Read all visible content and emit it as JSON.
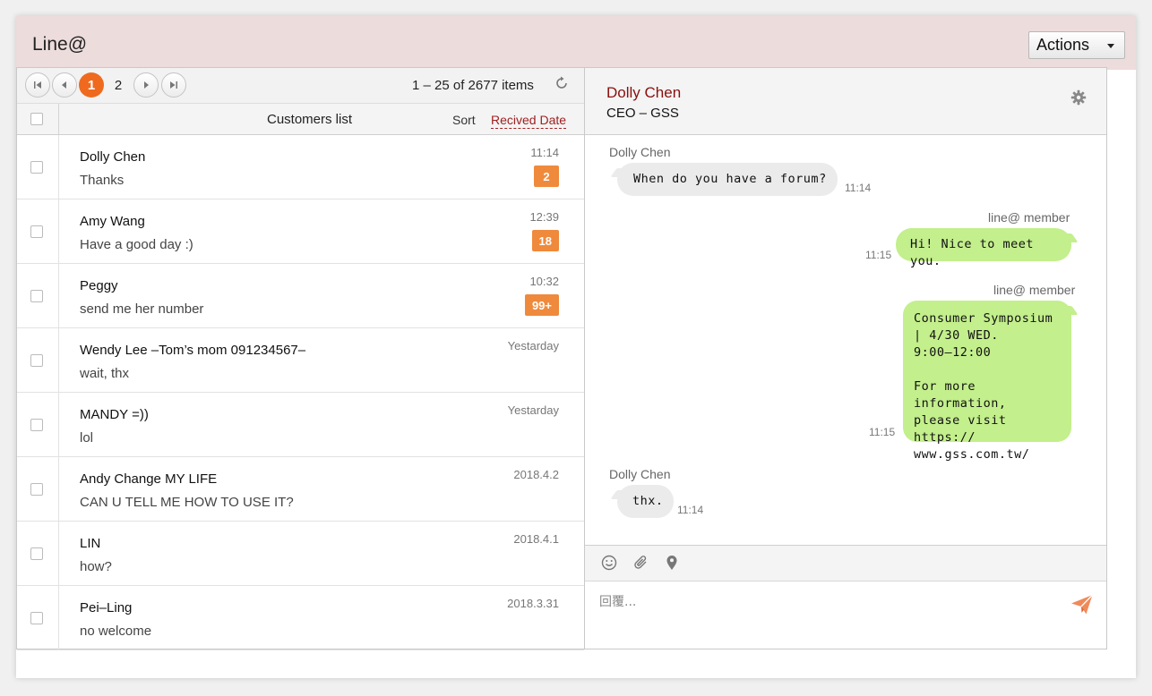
{
  "app": {
    "title": "Line@",
    "actions_label": "Actions"
  },
  "pager": {
    "pages": [
      "1",
      "2"
    ],
    "active_page": "1",
    "items_info": "1 – 25 of 2677 items"
  },
  "list_header": {
    "title": "Customers list",
    "sort_label": "Sort",
    "sort_value": "Recived Date"
  },
  "customers": [
    {
      "name": "Dolly Chen",
      "message": "Thanks",
      "time": "11:14",
      "badge": "2"
    },
    {
      "name": "Amy Wang",
      "message": "Have a good day :)",
      "time": "12:39",
      "badge": "18"
    },
    {
      "name": "Peggy",
      "message": "send me her number",
      "time": "10:32",
      "badge": "99+"
    },
    {
      "name": "Wendy Lee –Tom’s mom 091234567–",
      "message": "wait, thx",
      "time": "Yestarday",
      "badge": ""
    },
    {
      "name": "MANDY =))",
      "message": "lol",
      "time": "Yestarday",
      "badge": ""
    },
    {
      "name": "Andy Change MY LIFE",
      "message": "CAN U TELL ME HOW TO USE IT?",
      "time": "2018.4.2",
      "badge": ""
    },
    {
      "name": "LIN",
      "message": "how?",
      "time": "2018.4.1",
      "badge": ""
    },
    {
      "name": "Pei–Ling",
      "message": "no welcome",
      "time": "2018.3.31",
      "badge": ""
    }
  ],
  "chat": {
    "contact_name": "Dolly Chen",
    "contact_role": "CEO – GSS",
    "messages": [
      {
        "sender": "Dolly Chen",
        "text": "When do you have a forum?",
        "time": "11:14",
        "direction": "in"
      },
      {
        "sender": "line@ member",
        "text": "Hi! Nice to meet you.",
        "time": "11:15",
        "direction": "out"
      },
      {
        "sender": "line@ member",
        "text": "Consumer Symposium\n| 4/30 WED.\n9:00–12:00\n\nFor more information,\nplease visit https://\nwww.gss.com.tw/",
        "time": "11:15",
        "direction": "out"
      },
      {
        "sender": "Dolly Chen",
        "text": "thx.",
        "time": "11:14",
        "direction": "in"
      }
    ],
    "reply_placeholder": "回覆..."
  },
  "icons": {
    "first": "first-page-icon",
    "prev": "prev-page-icon",
    "next": "next-page-icon",
    "last": "last-page-icon",
    "refresh": "refresh-icon",
    "settings": "gear-icon",
    "emoji": "emoji-icon",
    "attach": "paperclip-icon",
    "location": "location-pin-icon",
    "send": "send-icon"
  },
  "colors": {
    "header_bg": "#eddcdc",
    "accent": "#ef6a1f",
    "badge": "#ef8a3c",
    "contact_name": "#8b0e0e",
    "outgoing_bubble": "#c3ef8c",
    "incoming_bubble": "#ebebeb"
  }
}
